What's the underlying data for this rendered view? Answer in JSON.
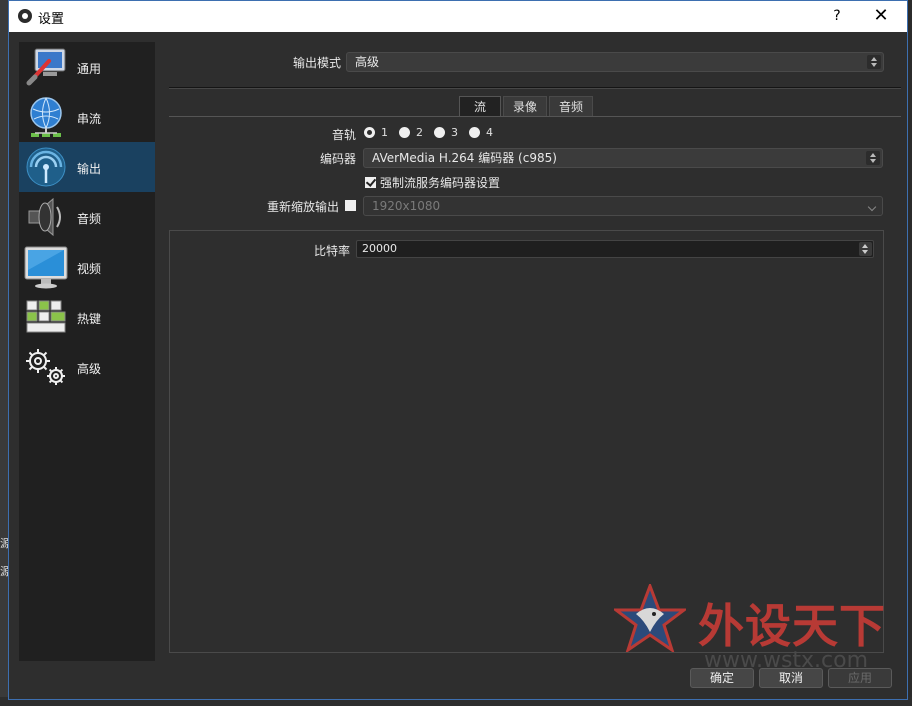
{
  "window": {
    "title": "设置",
    "help_label": "?",
    "close_label": "✕"
  },
  "background_fragments": [
    "源",
    "源"
  ],
  "sidebar": {
    "items": [
      {
        "label": "通用",
        "icon": "general-settings-icon",
        "active": false
      },
      {
        "label": "串流",
        "icon": "globe-network-icon",
        "active": false
      },
      {
        "label": "输出",
        "icon": "broadcast-antenna-icon",
        "active": true
      },
      {
        "label": "音频",
        "icon": "speaker-icon",
        "active": false
      },
      {
        "label": "视频",
        "icon": "monitor-icon",
        "active": false
      },
      {
        "label": "热键",
        "icon": "keyboard-icon",
        "active": false
      },
      {
        "label": "高级",
        "icon": "gears-icon",
        "active": false
      }
    ]
  },
  "output": {
    "mode_label": "输出模式",
    "mode_value": "高级",
    "tabs": [
      {
        "label": "流",
        "active": true
      },
      {
        "label": "录像",
        "active": false
      },
      {
        "label": "音频",
        "active": false
      }
    ],
    "audio_track_label": "音轨",
    "audio_tracks": [
      {
        "label": "1",
        "checked": true
      },
      {
        "label": "2",
        "checked": false
      },
      {
        "label": "3",
        "checked": false
      },
      {
        "label": "4",
        "checked": false
      }
    ],
    "encoder_label": "编码器",
    "encoder_value": "AVerMedia H.264 编码器 (c985)",
    "enforce_label": "强制流服务编码器设置",
    "enforce_checked": true,
    "rescale_label": "重新缩放输出",
    "rescale_checked": false,
    "rescale_value": "1920x1080",
    "bitrate_label": "比特率",
    "bitrate_value": "20000"
  },
  "watermark": {
    "text": "外设天下",
    "url": "www.wstx.com"
  },
  "buttons": {
    "ok": "确定",
    "cancel": "取消",
    "apply": "应用"
  }
}
